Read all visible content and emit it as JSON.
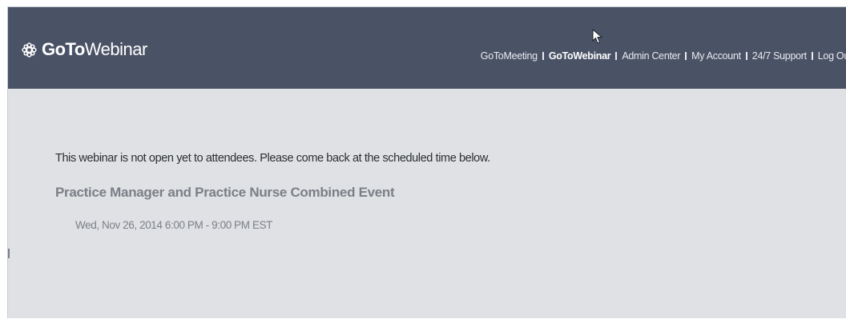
{
  "brand": {
    "bold": "GoTo",
    "light": "Webinar",
    "icon": "gear-logo-icon",
    "color": "#ffffff"
  },
  "header": {
    "background": "#4a5266",
    "nav": [
      {
        "label": "GoToMeeting",
        "active": false
      },
      {
        "label": "GoToWebinar",
        "active": true
      },
      {
        "label": "Admin Center",
        "active": false
      },
      {
        "label": "My Account",
        "active": false
      },
      {
        "label": "24/7 Support",
        "active": false
      },
      {
        "label": "Log Ou",
        "active": false
      }
    ]
  },
  "main": {
    "notice": "This webinar is not open yet to attendees. Please come back at the scheduled time below.",
    "event_title": "Practice Manager and Practice Nurse Combined Event",
    "event_time": "Wed, Nov 26, 2014 6:00 PM - 9:00 PM EST",
    "background": "#dfe1e4"
  }
}
